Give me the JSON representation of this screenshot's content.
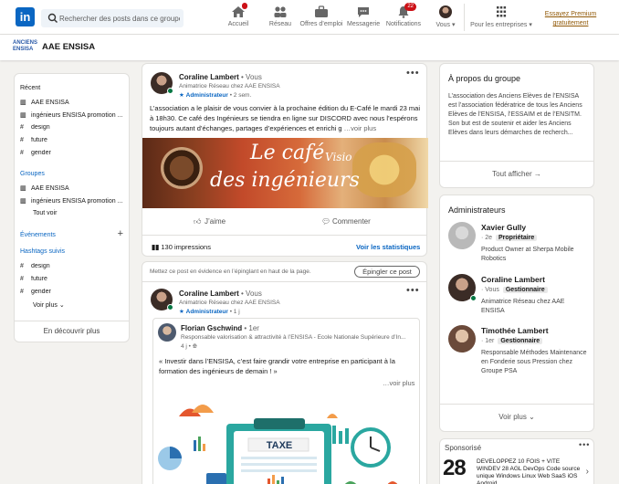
{
  "nav": {
    "search_placeholder": "Rechercher des posts dans ce groupe",
    "items": [
      {
        "label": "Accueil",
        "icon": "home-icon"
      },
      {
        "label": "Réseau",
        "icon": "network-icon"
      },
      {
        "label": "Offres d’emploi",
        "icon": "jobs-icon"
      },
      {
        "label": "Messagerie",
        "icon": "messaging-icon"
      },
      {
        "label": "Notifications",
        "icon": "bell-icon",
        "badge": "22"
      },
      {
        "label": "Vous ▾",
        "icon": "avatar"
      },
      {
        "label": "Pour les entreprises ▾",
        "icon": "grid-icon"
      }
    ],
    "premium": "Essayez Premium gratuitement"
  },
  "group": {
    "logo_text": "ANCIENS ENSISA",
    "name": "AAE ENSISA"
  },
  "left": {
    "recent_title": "Récent",
    "recent": [
      {
        "icon": "group-icon",
        "label": "AAE ENSISA"
      },
      {
        "icon": "group-icon",
        "label": "ingénieurs ENSISA promotion ..."
      },
      {
        "icon": "hashtag-icon",
        "label": "design"
      },
      {
        "icon": "hashtag-icon",
        "label": "future"
      },
      {
        "icon": "hashtag-icon",
        "label": "gender"
      }
    ],
    "groups_title": "Groupes",
    "groups": [
      {
        "icon": "group-icon",
        "label": "AAE ENSISA"
      },
      {
        "icon": "group-icon",
        "label": "ingénieurs ENSISA promotion ..."
      }
    ],
    "see_all": "Tout voir",
    "events_title": "Événements",
    "hashtags_title": "Hashtags suivis",
    "hashtags": [
      "design",
      "future",
      "gender"
    ],
    "see_more": "Voir plus",
    "discover": "En découvrir plus"
  },
  "post1": {
    "author": "Coraline Lambert",
    "degree": "• Vous",
    "subtitle": "Animatrice Réseau chez AAE ENSISA",
    "role": "Administrateur",
    "time": "• 2 sem.",
    "text": "L’association a le plaisir de vous convier à la prochaine édition du E-Café le mardi 23 mai à 18h30. Ce café des Ingénieurs se tiendra en ligne sur DISCORD avec nous l’espérons toujours autant d’échanges, partages d’expériences et enrichi ɡ",
    "see_more": "…voir plus",
    "banner_line1": "Le café",
    "banner_visio": "Visio",
    "banner_line2": "des ingénieurs",
    "like": "J’aime",
    "comment": "Commenter",
    "impressions": "130 impressions",
    "stats": "Voir les statistiques"
  },
  "post2": {
    "pin_hint": "Mettez ce post en évidence en l’épinglant en haut de la page.",
    "pin_button": "Épingler ce post",
    "author": "Coraline Lambert",
    "degree": "• Vous",
    "subtitle": "Animatrice Réseau chez AAE ENSISA",
    "role": "Administrateur",
    "time": "• 1 j",
    "shared_author": "Florian Gschwind",
    "shared_degree": "• 1er",
    "shared_subtitle": "Responsable valorisation & attractivité à l’ENSISA - École Nationale Supérieure d’In...",
    "shared_time": "4 j • ",
    "shared_text": "« Investir dans l’ENSISA, c’est faire grandir votre entreprise en participant à la formation des ingénieurs de demain ! »",
    "shared_more": "…voir plus",
    "illu_label": "TAXE"
  },
  "about": {
    "title": "À propos du groupe",
    "desc": "L’association des Anciens Elèves de l’ENSISA est l’association fédératrice de tous les Anciens Elèves de l’ENSISA, l’ESSAIM et de l’ENSITM. Son but est de soutenir et aider les Anciens Elèves dans leurs démarches de recherch...",
    "show_all": "Tout afficher →"
  },
  "admins": {
    "title": "Administrateurs",
    "list": [
      {
        "name": "Xavier Gully",
        "degree": "· 2e",
        "tag": "Propriétaire",
        "desc": "Product Owner at Sherpa Mobile Robotics"
      },
      {
        "name": "Coraline Lambert",
        "degree": "· Vous",
        "tag": "Gestionnaire",
        "desc": "Animatrice Réseau chez AAE ENSISA"
      },
      {
        "name": "Timothée Lambert",
        "degree": "· 1er",
        "tag": "Gestionnaire",
        "desc": "Responsable Méthodes Maintenance en Fonderie sous Pression chez Groupe PSA"
      }
    ],
    "see_more": "Voir plus"
  },
  "sponsor": {
    "label": "Sponsorisé",
    "big": "28",
    "text": "DEVELOPPEZ 10 FOIS + VITE WINDEV 28 AGL DevOps Code source unique Windows Linux Web SaaS iOS Android"
  }
}
